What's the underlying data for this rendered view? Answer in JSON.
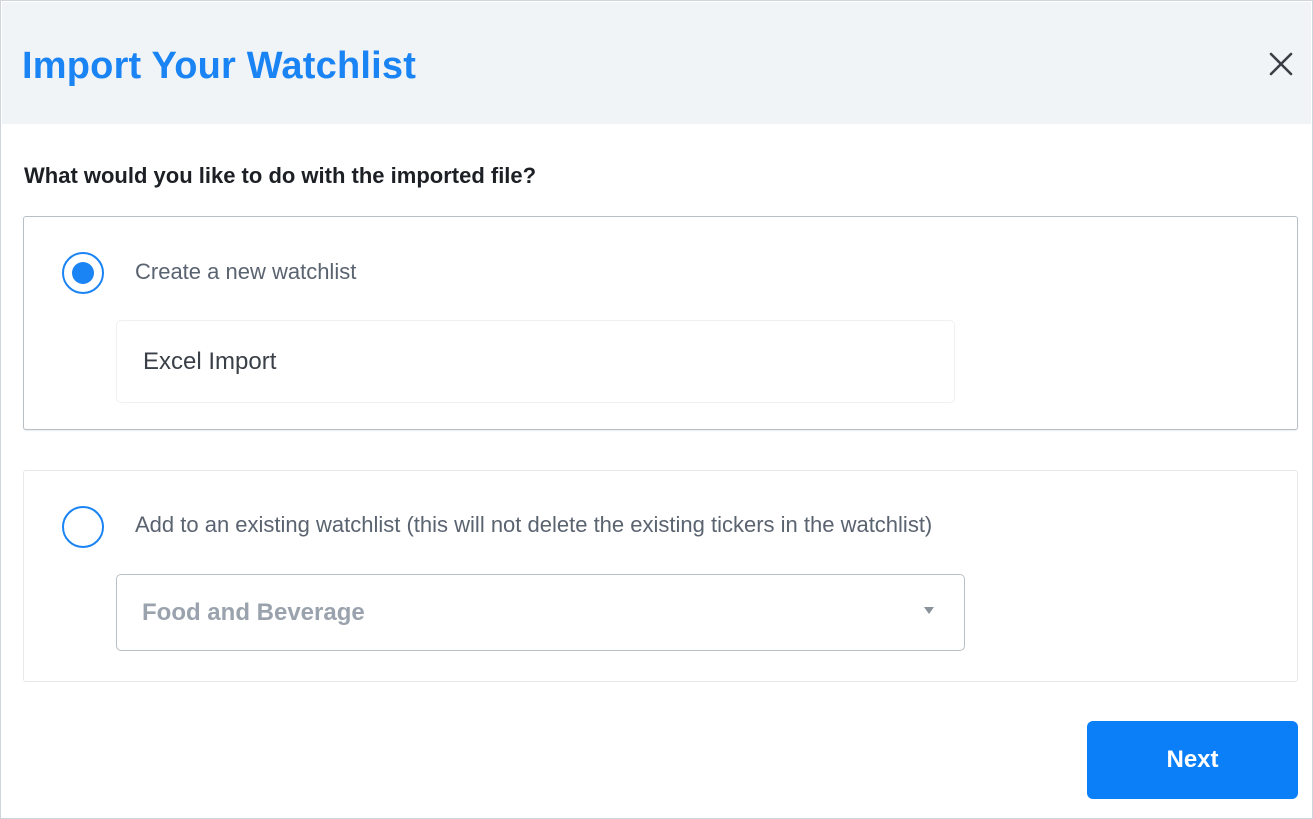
{
  "dialog": {
    "title": "Import Your Watchlist",
    "close_icon": "close-icon",
    "question": "What would you like to do with the imported file?"
  },
  "options": {
    "create_new": {
      "label": "Create a new watchlist",
      "selected": true,
      "input_value": "Excel Import"
    },
    "add_existing": {
      "label": "Add to an existing watchlist (this will not delete the existing tickers in the watchlist)",
      "selected": false,
      "select_value": "Food and Beverage",
      "arrow_icon": "caret-down-icon"
    }
  },
  "footer": {
    "next_label": "Next"
  },
  "colors": {
    "accent": "#1a84f4",
    "button": "#0b7ff7",
    "header_bg": "#f1f4f6"
  }
}
